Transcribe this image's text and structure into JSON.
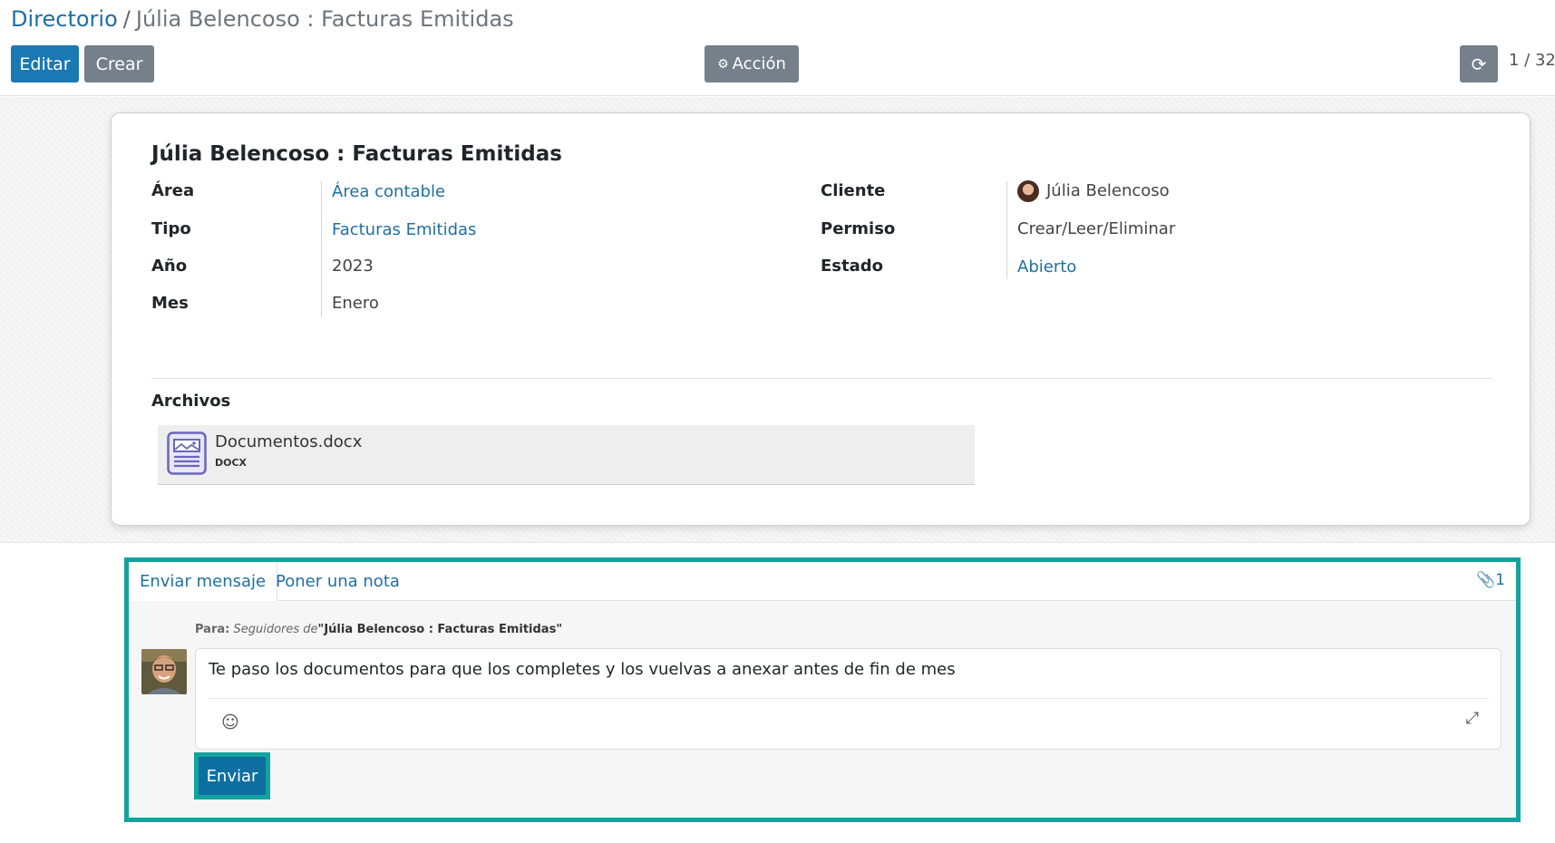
{
  "breadcrumb": {
    "parent": "Directorio",
    "separator": "/",
    "current": "Júlia Belencoso : Facturas Emitidas"
  },
  "toolbar": {
    "edit_label": "Editar",
    "create_label": "Crear",
    "action_label": "Acción",
    "action_icon": "gear-icon",
    "refresh_icon": "refresh-icon",
    "pager": "1 / 32"
  },
  "record": {
    "title": "Júlia Belencoso : Facturas Emitidas",
    "left_fields": [
      {
        "label": "Área",
        "value": "Área contable",
        "link": true
      },
      {
        "label": "Tipo",
        "value": "Facturas Emitidas",
        "link": true
      },
      {
        "label": "Año",
        "value": "2023",
        "link": false
      },
      {
        "label": "Mes",
        "value": "Enero",
        "link": false
      }
    ],
    "right_fields": [
      {
        "label": "Cliente",
        "value": "Júlia Belencoso",
        "link": false
      },
      {
        "label": "Permiso",
        "value": "Crear/Leer/Eliminar",
        "link": false
      },
      {
        "label": "Estado",
        "value": "Abierto",
        "link": true
      }
    ],
    "files_label": "Archivos",
    "file": {
      "name": "Documentos.docx",
      "ext": "DOCX"
    }
  },
  "chatter": {
    "tabs": [
      "Enviar mensaje",
      "Poner una nota"
    ],
    "attachment_count": "1",
    "recipients_prefix": "Para:",
    "recipients_italic": "Seguidores de",
    "recipients_record": "\"Júlia Belencoso : Facturas Emitidas\"",
    "message": "Te paso los documentos para que los completes y los vuelvas a anexar antes de fin de mes",
    "send_label": "Enviar"
  },
  "colors": {
    "primary": "#1a78b2",
    "secondary": "#75808a",
    "link": "#1f6fa3",
    "highlight": "#12a39f"
  }
}
